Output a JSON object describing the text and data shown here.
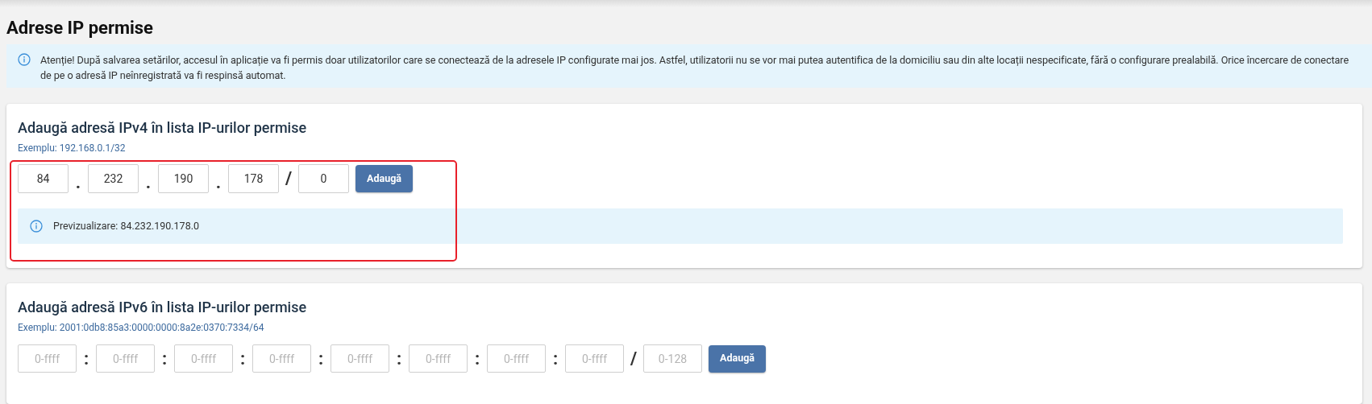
{
  "page_title": "Adrese IP permise",
  "alert": {
    "text": "Atenție! După salvarea setărilor, accesul în aplicație va fi permis doar utilizatorilor care se conectează de la adresele IP configurate mai jos. Astfel, utilizatorii nu se vor mai putea autentifica de la domiciliu sau din alte locații nespecificate, fără o configurare prealabilă. Orice încercare de conectare de pe o adresă IP neînregistrată va fi respinsă automat."
  },
  "sections": [
    {
      "title": "Adaugă adresă IPv4 în lista IP-urilor permise",
      "example": "Exemplu: 192.168.0.1/32",
      "highlighted": true,
      "parts": [
        {
          "kind": "field",
          "value": "84"
        },
        {
          "kind": "separator",
          "text": "."
        },
        {
          "kind": "field",
          "value": "232"
        },
        {
          "kind": "separator",
          "text": "."
        },
        {
          "kind": "field",
          "value": "190"
        },
        {
          "kind": "separator",
          "text": "."
        },
        {
          "kind": "field",
          "value": "178"
        },
        {
          "kind": "separator",
          "text": "/"
        },
        {
          "kind": "field",
          "value": "0"
        }
      ],
      "button": "Adaugă",
      "preview": "Previzualizare: 84.232.190.178.0"
    },
    {
      "title": "Adaugă adresă IPv6 în lista IP-urilor permise",
      "example": "Exemplu: 2001:0db8:85a3:0000:0000:8a2e:0370:7334/64",
      "highlighted": false,
      "parts": [
        {
          "kind": "field",
          "placeholder": "0-ffff"
        },
        {
          "kind": "separator",
          "text": ":"
        },
        {
          "kind": "field",
          "placeholder": "0-ffff"
        },
        {
          "kind": "separator",
          "text": ":"
        },
        {
          "kind": "field",
          "placeholder": "0-ffff"
        },
        {
          "kind": "separator",
          "text": ":"
        },
        {
          "kind": "field",
          "placeholder": "0-ffff"
        },
        {
          "kind": "separator",
          "text": ":"
        },
        {
          "kind": "field",
          "placeholder": "0-ffff"
        },
        {
          "kind": "separator",
          "text": ":"
        },
        {
          "kind": "field",
          "placeholder": "0-ffff"
        },
        {
          "kind": "separator",
          "text": ":"
        },
        {
          "kind": "field",
          "placeholder": "0-ffff"
        },
        {
          "kind": "separator",
          "text": ":"
        },
        {
          "kind": "field",
          "placeholder": "0-ffff"
        },
        {
          "kind": "separator",
          "text": "/"
        },
        {
          "kind": "field",
          "placeholder": "0-128"
        }
      ],
      "button": "Adaugă"
    }
  ]
}
